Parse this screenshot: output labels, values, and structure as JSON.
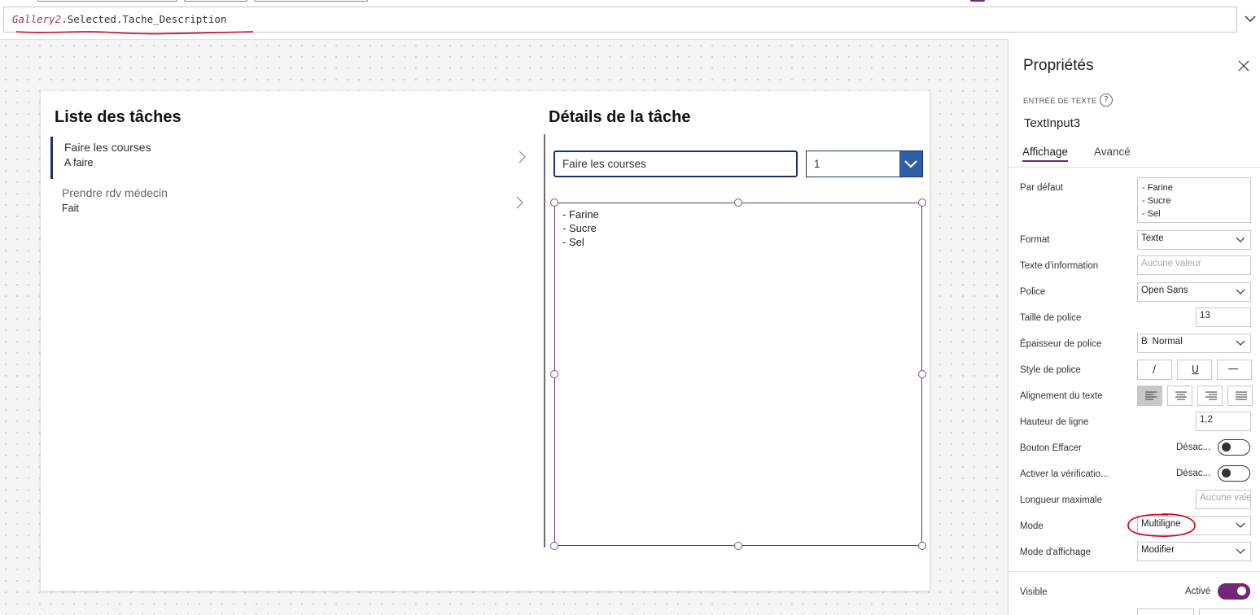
{
  "formula_bar": {
    "control": "Gallery2",
    "expression_rest": ".Selected.Tache_Description"
  },
  "canvas": {
    "list": {
      "title": "Liste des tâches",
      "items": [
        {
          "title": "Faire les courses",
          "status": "A faire",
          "selected": true
        },
        {
          "title": "Prendre rdv médecin",
          "status": "Fait",
          "selected": false
        }
      ]
    },
    "detail": {
      "title": "Détails de la tâche",
      "name_value": "Faire les courses",
      "priority_value": "1",
      "description": "- Farine\n- Sucre\n- Sel"
    }
  },
  "properties": {
    "title": "Propriétés",
    "control_type": "ENTRÉE DE TEXTE",
    "help_icon": "?",
    "control_name": "TextInput3",
    "tabs": [
      {
        "label": "Affichage",
        "active": true
      },
      {
        "label": "Avancé",
        "active": false
      }
    ],
    "rows": {
      "default_label": "Par défaut",
      "default_value": "- Farine\n- Sucre\n- Sel",
      "format_label": "Format",
      "format_value": "Texte",
      "hint_label": "Texte d'information",
      "hint_placeholder": "Aucune valeur",
      "font_label": "Police",
      "font_value": "Open Sans",
      "font_size_label": "Taille de police",
      "font_size_value": "13",
      "font_weight_label": "Épaisseur de police",
      "font_weight_value": "Normal",
      "font_weight_glyph": "B",
      "font_style_label": "Style de police",
      "font_style_buttons": [
        "/",
        "U",
        "—"
      ],
      "text_align_label": "Alignement du texte",
      "line_height_label": "Hauteur de ligne",
      "line_height_value": "1,2",
      "clear_button_label": "Bouton Effacer",
      "clear_button_value": "Désac...",
      "spellcheck_label": "Activer la vérificatio...",
      "spellcheck_value": "Désac...",
      "max_length_label": "Longueur maximale",
      "max_length_placeholder": "Aucune vale",
      "mode_label": "Mode",
      "mode_value": "Multiligne",
      "display_mode_label": "Mode d'affichage",
      "display_mode_value": "Modifier",
      "visible_label": "Visible",
      "visible_value": "Activé"
    }
  },
  "colors": {
    "accent_purple": "#742774",
    "navy": "#1d2e6e",
    "dropdown_blue": "#2d5fa8",
    "annotation_red": "#d0021b"
  }
}
